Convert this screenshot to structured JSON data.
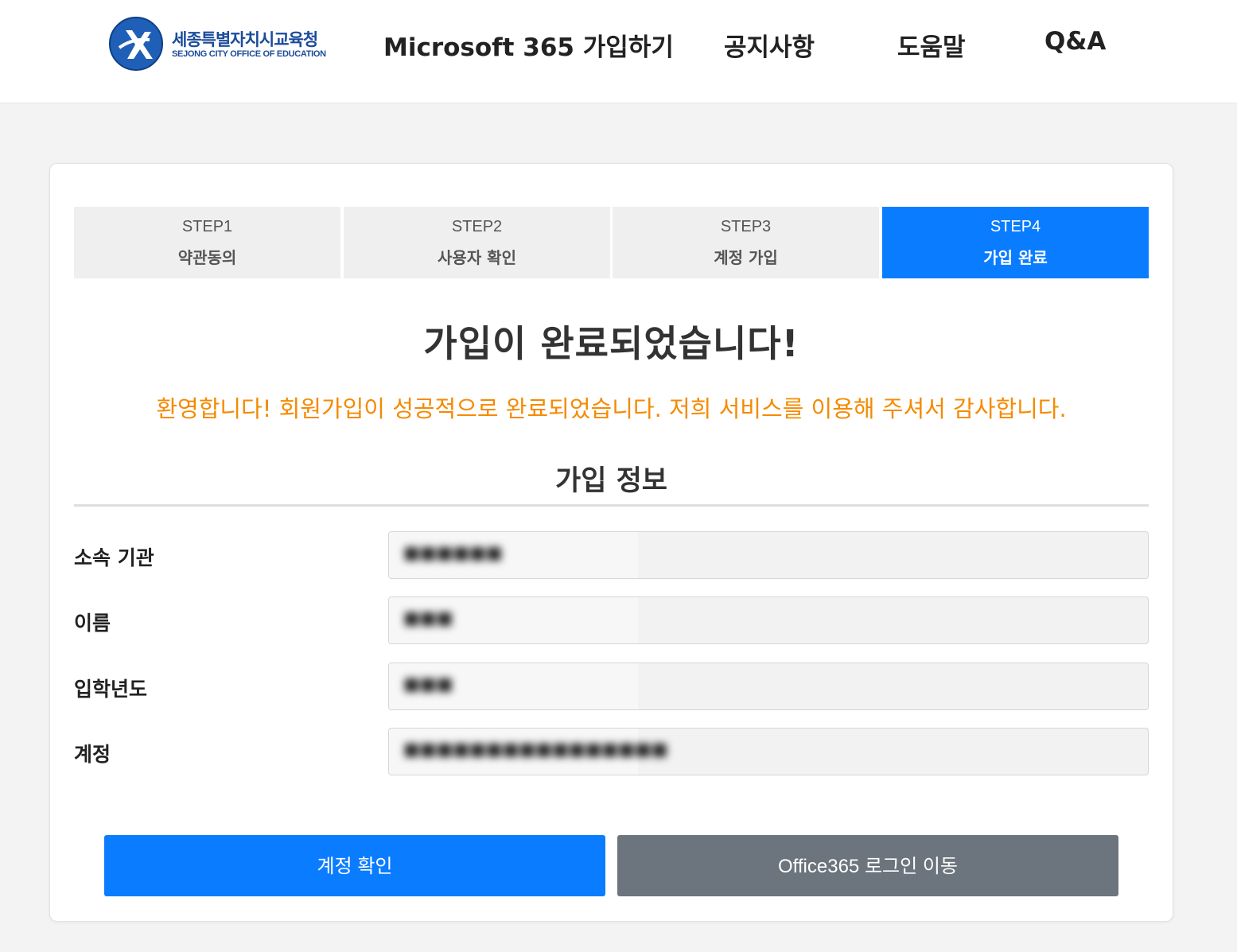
{
  "header": {
    "logo_text_kr": "세종특별자치시교육청",
    "logo_text_en": "SEJONG CITY OFFICE OF EDUCATION",
    "nav": [
      {
        "label": "Microsoft 365 가입하기"
      },
      {
        "label": "공지사항"
      },
      {
        "label": "도움말"
      },
      {
        "label": "Q&A"
      }
    ]
  },
  "steps": [
    {
      "num": "STEP1",
      "name": "약관동의",
      "active": false
    },
    {
      "num": "STEP2",
      "name": "사용자 확인",
      "active": false
    },
    {
      "num": "STEP3",
      "name": "계정 가입",
      "active": false
    },
    {
      "num": "STEP4",
      "name": "가입 완료",
      "active": true
    }
  ],
  "main": {
    "title": "가입이 완료되었습니다!",
    "welcome": "환영합니다! 회원가입이 성공적으로 완료되었습니다. 저희 서비스를 이용해 주셔서 감사합니다.",
    "section_title": "가입 정보",
    "info": [
      {
        "label": "소속 기관",
        "value": "■■■■■■"
      },
      {
        "label": "이름",
        "value": "■■■"
      },
      {
        "label": "입학년도",
        "value": "■■■"
      },
      {
        "label": "계정",
        "value": "■■■■■■■■■■■■■■■■"
      }
    ]
  },
  "buttons": {
    "confirm_label": "계정 확인",
    "login_label": "Office365 로그인 이동"
  },
  "colors": {
    "accent": "#0a7cff",
    "secondary": "#6c757d",
    "welcome": "#f58a00",
    "brand": "#1b4b9b"
  }
}
